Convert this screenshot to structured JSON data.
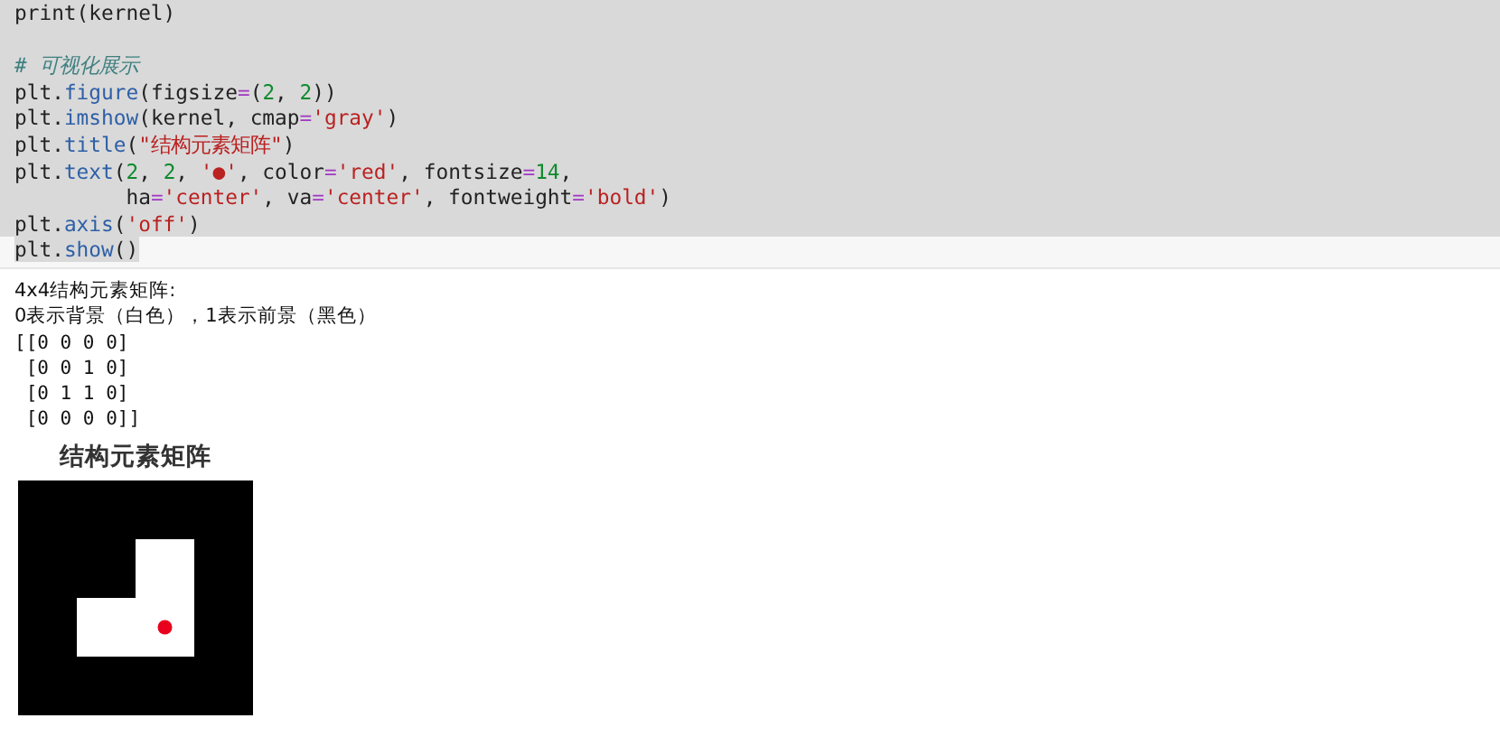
{
  "code_cell": {
    "lines": [
      {
        "selected": true,
        "tokens": [
          {
            "kind": "plain",
            "text": "print(kernel)"
          }
        ]
      },
      {
        "selected": true,
        "blank_before": true,
        "tokens": [
          {
            "kind": "comment",
            "text": "# 可视化展示"
          }
        ]
      },
      {
        "selected": true,
        "tokens": [
          {
            "kind": "plain",
            "text": "plt."
          },
          {
            "kind": "attr",
            "text": "figure"
          },
          {
            "kind": "plain",
            "text": "(figsize"
          },
          {
            "kind": "op",
            "text": "="
          },
          {
            "kind": "plain",
            "text": "("
          },
          {
            "kind": "number",
            "text": "2"
          },
          {
            "kind": "plain",
            "text": ", "
          },
          {
            "kind": "number",
            "text": "2"
          },
          {
            "kind": "plain",
            "text": "))"
          }
        ]
      },
      {
        "selected": true,
        "tokens": [
          {
            "kind": "plain",
            "text": "plt."
          },
          {
            "kind": "attr",
            "text": "imshow"
          },
          {
            "kind": "plain",
            "text": "(kernel, cmap"
          },
          {
            "kind": "op",
            "text": "="
          },
          {
            "kind": "string",
            "text": "'gray'"
          },
          {
            "kind": "plain",
            "text": ")"
          }
        ]
      },
      {
        "selected": true,
        "tokens": [
          {
            "kind": "plain",
            "text": "plt."
          },
          {
            "kind": "attr",
            "text": "title"
          },
          {
            "kind": "plain",
            "text": "("
          },
          {
            "kind": "string",
            "text": "\"结构元素矩阵\""
          },
          {
            "kind": "plain",
            "text": ")"
          }
        ]
      },
      {
        "selected": true,
        "tokens": [
          {
            "kind": "plain",
            "text": "plt."
          },
          {
            "kind": "attr",
            "text": "text"
          },
          {
            "kind": "plain",
            "text": "("
          },
          {
            "kind": "number",
            "text": "2"
          },
          {
            "kind": "plain",
            "text": ", "
          },
          {
            "kind": "number",
            "text": "2"
          },
          {
            "kind": "plain",
            "text": ", "
          },
          {
            "kind": "string",
            "text": "'●'"
          },
          {
            "kind": "plain",
            "text": ", color"
          },
          {
            "kind": "op",
            "text": "="
          },
          {
            "kind": "string",
            "text": "'red'"
          },
          {
            "kind": "plain",
            "text": ", fontsize"
          },
          {
            "kind": "op",
            "text": "="
          },
          {
            "kind": "number",
            "text": "14"
          },
          {
            "kind": "plain",
            "text": ","
          }
        ]
      },
      {
        "selected": true,
        "tokens": [
          {
            "kind": "plain",
            "text": "         ha"
          },
          {
            "kind": "op",
            "text": "="
          },
          {
            "kind": "string",
            "text": "'center'"
          },
          {
            "kind": "plain",
            "text": ", va"
          },
          {
            "kind": "op",
            "text": "="
          },
          {
            "kind": "string",
            "text": "'center'"
          },
          {
            "kind": "plain",
            "text": ", fontweight"
          },
          {
            "kind": "op",
            "text": "="
          },
          {
            "kind": "string",
            "text": "'bold'"
          },
          {
            "kind": "plain",
            "text": ")"
          }
        ]
      },
      {
        "selected": true,
        "tokens": [
          {
            "kind": "plain",
            "text": "plt."
          },
          {
            "kind": "attr",
            "text": "axis"
          },
          {
            "kind": "plain",
            "text": "("
          },
          {
            "kind": "string",
            "text": "'off'"
          },
          {
            "kind": "plain",
            "text": ")"
          }
        ]
      },
      {
        "selected": false,
        "tokens": [
          {
            "kind": "plain",
            "text": "plt."
          },
          {
            "kind": "attr",
            "text": "show"
          },
          {
            "kind": "plain",
            "text": "()"
          }
        ]
      }
    ]
  },
  "output": {
    "lines": [
      {
        "kind": "text",
        "text": "4x4结构元素矩阵:"
      },
      {
        "kind": "text",
        "text": "0表示背景（白色），1表示前景（黑色）"
      },
      {
        "kind": "mono",
        "text": "[[0 0 0 0]"
      },
      {
        "kind": "mono",
        "text": " [0 0 1 0]"
      },
      {
        "kind": "mono",
        "text": " [0 1 1 0]"
      },
      {
        "kind": "mono",
        "text": " [0 0 0 0]]"
      }
    ],
    "figure": {
      "title": "结构元素矩阵"
    }
  }
}
